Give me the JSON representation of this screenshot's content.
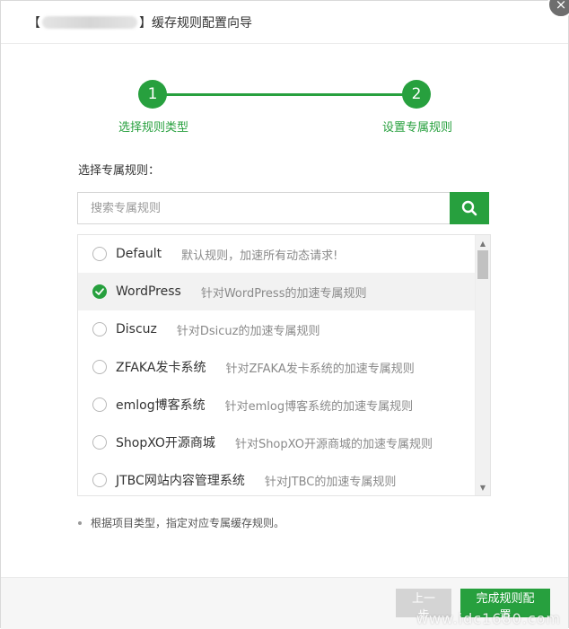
{
  "header": {
    "bracket_open": "【",
    "bracket_close": "】",
    "title": "缓存规则配置向导",
    "close_glyph": "×"
  },
  "steps": [
    {
      "number": "1",
      "label": "选择规则类型"
    },
    {
      "number": "2",
      "label": "设置专属规则"
    }
  ],
  "section_label": "选择专属规则：",
  "search": {
    "placeholder": "搜索专属规则",
    "value": "",
    "icon": "search-icon"
  },
  "rules": [
    {
      "name": "Default",
      "desc": "默认规则，加速所有动态请求!",
      "selected": false
    },
    {
      "name": "WordPress",
      "desc": "针对WordPress的加速专属规则",
      "selected": true
    },
    {
      "name": "Discuz",
      "desc": "针对Dsicuz的加速专属规则",
      "selected": false
    },
    {
      "name": "ZFAKA发卡系统",
      "desc": "针对ZFAKA发卡系统的加速专属规则",
      "selected": false
    },
    {
      "name": "emlog博客系统",
      "desc": "针对emlog博客系统的加速专属规则",
      "selected": false
    },
    {
      "name": "ShopXO开源商城",
      "desc": "针对ShopXO开源商城的加速专属规则",
      "selected": false
    },
    {
      "name": "JTBC网站内容管理系统",
      "desc": "针对JTBC的加速专属规则",
      "selected": false
    }
  ],
  "tip": "根据项目类型，指定对应专属缓存规则。",
  "footer": {
    "prev_label": "上一步",
    "finish_label": "完成规则配置",
    "watermark": "www.idc1680.com"
  },
  "colors": {
    "accent": "#27a03e",
    "disabled": "#d4d4d4"
  }
}
